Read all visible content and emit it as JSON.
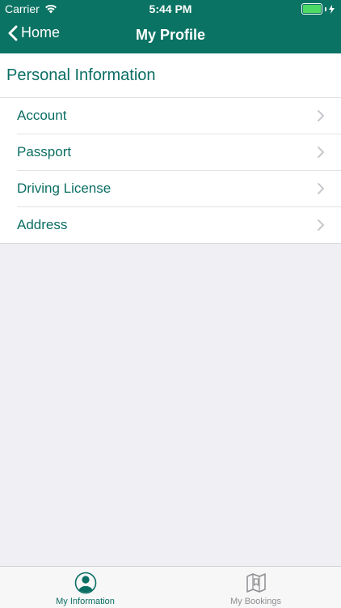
{
  "status_bar": {
    "carrier": "Carrier",
    "time": "5:44 PM"
  },
  "nav": {
    "back_label": "Home",
    "title": "My Profile"
  },
  "section": {
    "title": "Personal Information"
  },
  "items": [
    {
      "label": "Account"
    },
    {
      "label": "Passport"
    },
    {
      "label": "Driving License"
    },
    {
      "label": "Address"
    }
  ],
  "tabs": [
    {
      "label": "My Information",
      "icon": "person-icon",
      "active": true
    },
    {
      "label": "My Bookings",
      "icon": "bookings-icon",
      "active": false
    }
  ],
  "colors": {
    "brand": "#0a7363",
    "accent_text": "#0a6e63",
    "inactive": "#8e8e93"
  }
}
